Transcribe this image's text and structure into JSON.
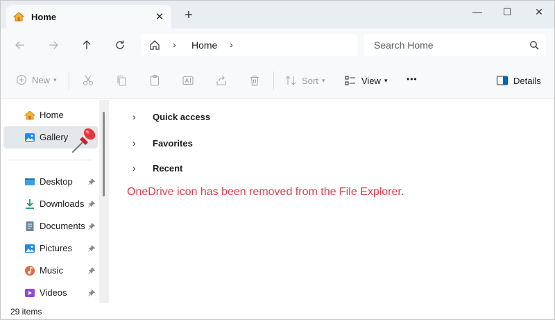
{
  "tab": {
    "title": "Home",
    "close_glyph": "✕",
    "new_tab_glyph": "+"
  },
  "window_controls": {
    "minimize": "—",
    "maximize": "☐",
    "close": "✕"
  },
  "address": {
    "crumb": "Home",
    "separator": "›"
  },
  "search": {
    "placeholder": "Search Home"
  },
  "commands": {
    "new": "New",
    "sort": "Sort",
    "view": "View",
    "more": "•••",
    "details": "Details"
  },
  "sidebar": {
    "top_items": [
      {
        "label": "Home",
        "icon": "home-icon"
      },
      {
        "label": "Gallery",
        "icon": "gallery-icon"
      }
    ],
    "pinned_items": [
      {
        "label": "Desktop",
        "icon": "desktop-icon"
      },
      {
        "label": "Downloads",
        "icon": "downloads-icon"
      },
      {
        "label": "Documents",
        "icon": "documents-icon"
      },
      {
        "label": "Pictures",
        "icon": "pictures-icon"
      },
      {
        "label": "Music",
        "icon": "music-icon"
      },
      {
        "label": "Videos",
        "icon": "videos-icon"
      }
    ]
  },
  "content": {
    "sections": [
      {
        "label": "Quick access"
      },
      {
        "label": "Favorites"
      },
      {
        "label": "Recent"
      }
    ],
    "note": "OneDrive icon has been removed from the File Explorer.",
    "note_color": "#d6404a"
  },
  "status": {
    "item_count": "29 items"
  },
  "colors": {
    "accent": "#0067c0",
    "folder": "#f3b52f",
    "selected_bg": "#e4e7ea"
  }
}
